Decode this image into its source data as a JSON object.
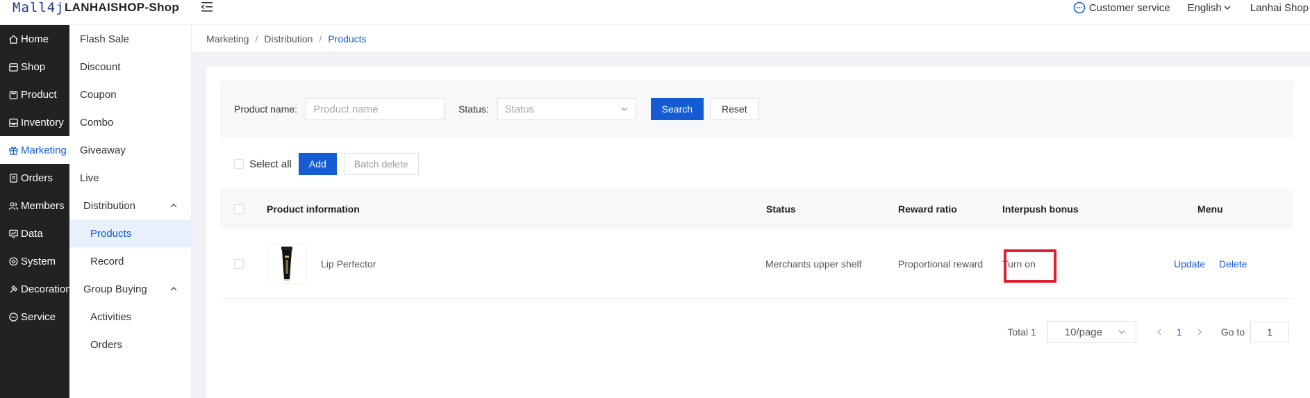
{
  "header": {
    "logo_text": "Mall4j",
    "shop_name": "LANHAISHOP-Shop",
    "customer_service": "Customer service",
    "language": "English",
    "user": "Lanhai Shop"
  },
  "sidebar": {
    "items": [
      {
        "label": "Home",
        "icon": "home-icon"
      },
      {
        "label": "Shop",
        "icon": "shop-icon"
      },
      {
        "label": "Product",
        "icon": "product-icon"
      },
      {
        "label": "Inventory",
        "icon": "inventory-icon"
      },
      {
        "label": "Marketing",
        "icon": "gift-icon"
      },
      {
        "label": "Orders",
        "icon": "orders-icon"
      },
      {
        "label": "Members",
        "icon": "members-icon"
      },
      {
        "label": "Data",
        "icon": "data-icon"
      },
      {
        "label": "System",
        "icon": "gear-icon"
      },
      {
        "label": "Decoration",
        "icon": "decoration-icon"
      },
      {
        "label": "Service",
        "icon": "service-icon"
      }
    ]
  },
  "submenu": {
    "items": [
      {
        "label": "Flash Sale"
      },
      {
        "label": "Discount"
      },
      {
        "label": "Coupon"
      },
      {
        "label": "Combo"
      },
      {
        "label": "Giveaway"
      },
      {
        "label": "Live"
      },
      {
        "label": "Distribution"
      },
      {
        "label": "Products"
      },
      {
        "label": "Record"
      },
      {
        "label": "Group Buying"
      },
      {
        "label": "Activities"
      },
      {
        "label": "Orders"
      }
    ]
  },
  "breadcrumb": [
    "Marketing",
    "Distribution",
    "Products"
  ],
  "breadcrumb_sep": "/",
  "filter": {
    "product_name_label": "Product name:",
    "product_name_placeholder": "Product name",
    "status_label": "Status:",
    "status_placeholder": "Status",
    "search": "Search",
    "reset": "Reset"
  },
  "toolbar": {
    "select_all": "Select all",
    "add": "Add",
    "batch_delete": "Batch delete"
  },
  "table": {
    "headers": [
      "Product information",
      "Status",
      "Reward ratio",
      "Interpush bonus",
      "Menu"
    ],
    "rows": [
      {
        "product": "Lip Perfector",
        "status": "Merchants upper shelf",
        "reward_ratio": "Proportional reward",
        "interpush_bonus": "Turn on",
        "update": "Update",
        "delete": "Delete"
      }
    ]
  },
  "pagination": {
    "total": "Total 1",
    "page_size": "10/page",
    "current_page": "1",
    "goto_label": "Go to",
    "goto_value": "1"
  },
  "colors": {
    "accent": "#155bd4",
    "sidebar_bg": "#222222",
    "highlight": "#e0202e"
  }
}
